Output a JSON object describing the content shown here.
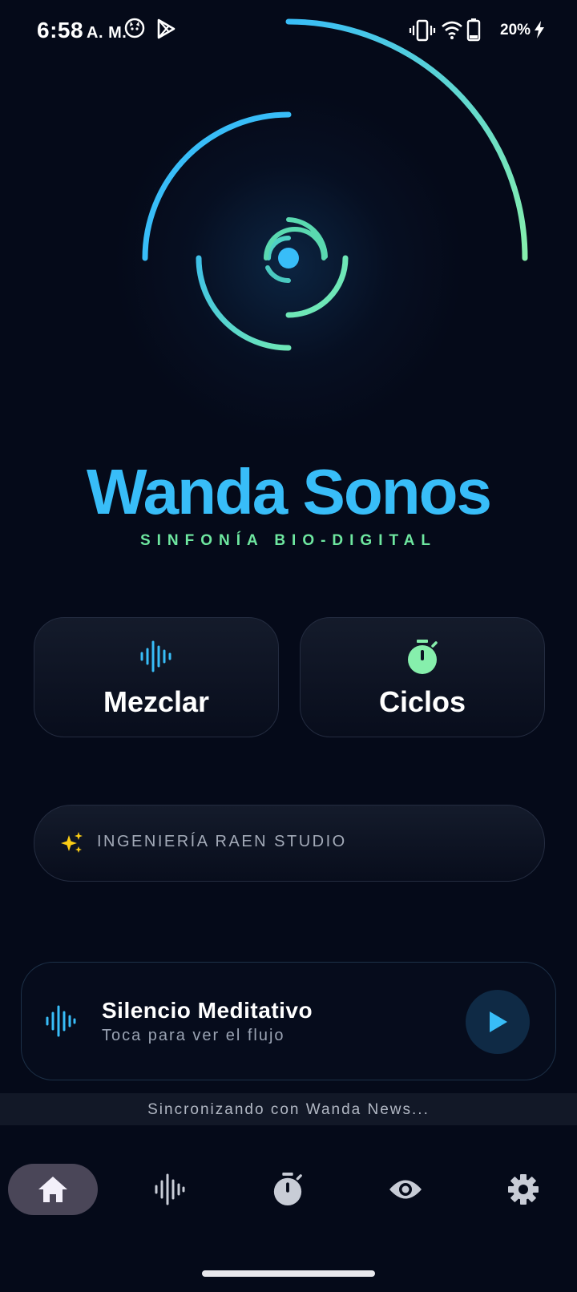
{
  "status_bar": {
    "time": "6:58",
    "ampm": "A. M.",
    "battery": "20%"
  },
  "app": {
    "title": "Wanda Sonos",
    "subtitle": "SINFONÍA BIO-DIGITAL"
  },
  "actions": {
    "mix_label": "Mezclar",
    "cycles_label": "Ciclos"
  },
  "studio": {
    "label": "INGENIERÍA RAEN STUDIO"
  },
  "now_playing": {
    "title": "Silencio Meditativo",
    "subtitle": "Toca para ver el flujo"
  },
  "sync_banner": "Sincronizando con Wanda News...",
  "nav": {
    "items": [
      "home-icon",
      "waveform-icon",
      "timer-icon",
      "eye-icon",
      "gear-icon"
    ],
    "active": "home-icon"
  },
  "colors": {
    "background": "#050a19",
    "accent_blue": "#38bdf8",
    "accent_green": "#6ee7a0"
  }
}
